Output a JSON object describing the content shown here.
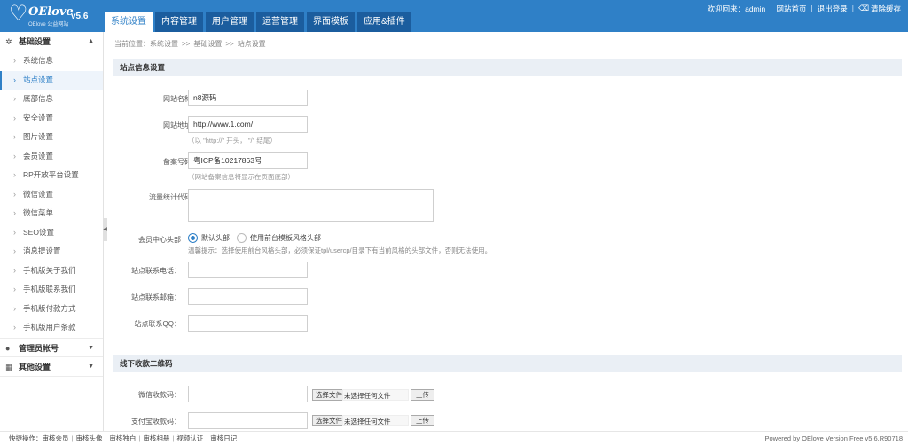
{
  "header": {
    "brand": "OElove",
    "brand_sub": "OElove 公益网站",
    "version": "v5.6",
    "tabs": [
      {
        "label": "系统设置"
      },
      {
        "label": "内容管理"
      },
      {
        "label": "用户管理"
      },
      {
        "label": "运营管理"
      },
      {
        "label": "界面模板"
      },
      {
        "label": "应用&插件"
      }
    ],
    "welcome": "欢迎回来：admin",
    "home_link": "网站首页",
    "logout_link": "退出登录",
    "clear_cache": "清除缓存"
  },
  "sidebar": {
    "group1": "基础设置",
    "items": [
      {
        "label": "系统信息"
      },
      {
        "label": "站点设置"
      },
      {
        "label": "底部信息"
      },
      {
        "label": "安全设置"
      },
      {
        "label": "图片设置"
      },
      {
        "label": "会员设置"
      },
      {
        "label": "RP开放平台设置"
      },
      {
        "label": "微信设置"
      },
      {
        "label": "微信菜单"
      },
      {
        "label": "SEO设置"
      },
      {
        "label": "消息提设置"
      },
      {
        "label": "手机版关于我们"
      },
      {
        "label": "手机版联系我们"
      },
      {
        "label": "手机版付款方式"
      },
      {
        "label": "手机版用户条款"
      }
    ],
    "group2": "管理员帐号",
    "group3": "其他设置"
  },
  "breadcrumb": {
    "prefix": "当前位置：系统设置",
    "sep": ">>",
    "level2": "基础设置",
    "level3": "站点设置"
  },
  "site_info": {
    "title": "站点信息设置",
    "site_name_label": "网站名称",
    "site_name_value": "n8源码",
    "site_url_label": "网站地址",
    "site_url_value": "http://www.1.com/",
    "site_url_hint": "（以 \"http://\" 开头， \"/\" 结尾）",
    "icp_label": "备案号码",
    "icp_value": "粤ICP备10217863号",
    "icp_hint": "（网站备案信息将显示在页面底部）",
    "stats_label": "流量统计代码",
    "member_header_label": "会员中心头部",
    "radio_default": "默认头部",
    "radio_theme": "使用前台模板风格头部",
    "member_header_hint": "温馨提示：选择使用前台风格头部，必须保证tpl/usercp/目录下有当前风格的头部文件，否则无法使用。",
    "phone_label": "站点联系电话：",
    "email_label": "站点联系邮箱：",
    "qq_label": "站点联系QQ："
  },
  "qrcode": {
    "title": "线下收款二维码",
    "wechat_label": "微信收款码：",
    "alipay_label": "支付宝收款码：",
    "choose_file": "选择文件",
    "no_file": "未选择任何文件",
    "upload": "上传"
  },
  "footer": {
    "quick_label": "快捷操作：",
    "links": [
      "审核会员",
      "审核头像",
      "审核独白",
      "审核相册",
      "视频认证",
      "审核日记"
    ],
    "powered": "Powered by OElove Version Free v5.6.R90718"
  }
}
